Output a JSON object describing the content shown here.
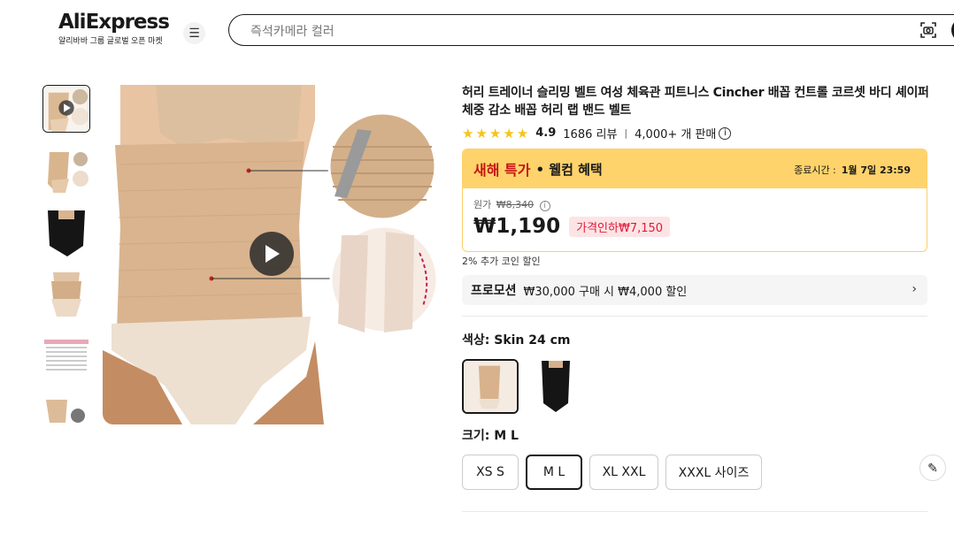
{
  "header": {
    "logo_text": "AliExpress",
    "logo_sub": "알리바바 그룹 글로벌 오픈 마켓",
    "search_placeholder": "즉석카메라 컬러",
    "menu_icon": "hamburger-icon",
    "camera_icon": "camera-search-icon"
  },
  "product": {
    "title": "허리 트레이너 슬리밍 벨트 여성 체육관 피트니스 Cincher 배꼽 컨트롤 코르셋 바디 셰이퍼 체중 감소 배꼽 허리 랩 밴드 벨트",
    "rating": "4.9",
    "reviews": "1686 리뷰",
    "sold": "4,000+ 개 판매"
  },
  "deal": {
    "title": "새해 특가",
    "subtitle": "• 웰컴 혜택",
    "end_label": "종료시간 :",
    "end_time": "1월 7일 23:59",
    "orig_label": "원가",
    "orig_price": "₩8,340",
    "price": "₩1,190",
    "discount": "가격인하₩7,150"
  },
  "coin_text": "2% 추가 코인 할인",
  "promo": {
    "label": "프로모션",
    "text": "₩30,000 구매 시 ₩4,000 할인"
  },
  "color": {
    "label": "색상: Skin 24 cm"
  },
  "size": {
    "label": "크기: M L",
    "options": [
      "XS S",
      "M L",
      "XL XXL",
      "XXXL 사이즈"
    ],
    "selected_index": 1
  },
  "colors": {
    "accent_red": "#c51414",
    "deal_yellow": "#ffd36b",
    "discount_bg": "#fde4e4",
    "star": "#f5c518"
  }
}
